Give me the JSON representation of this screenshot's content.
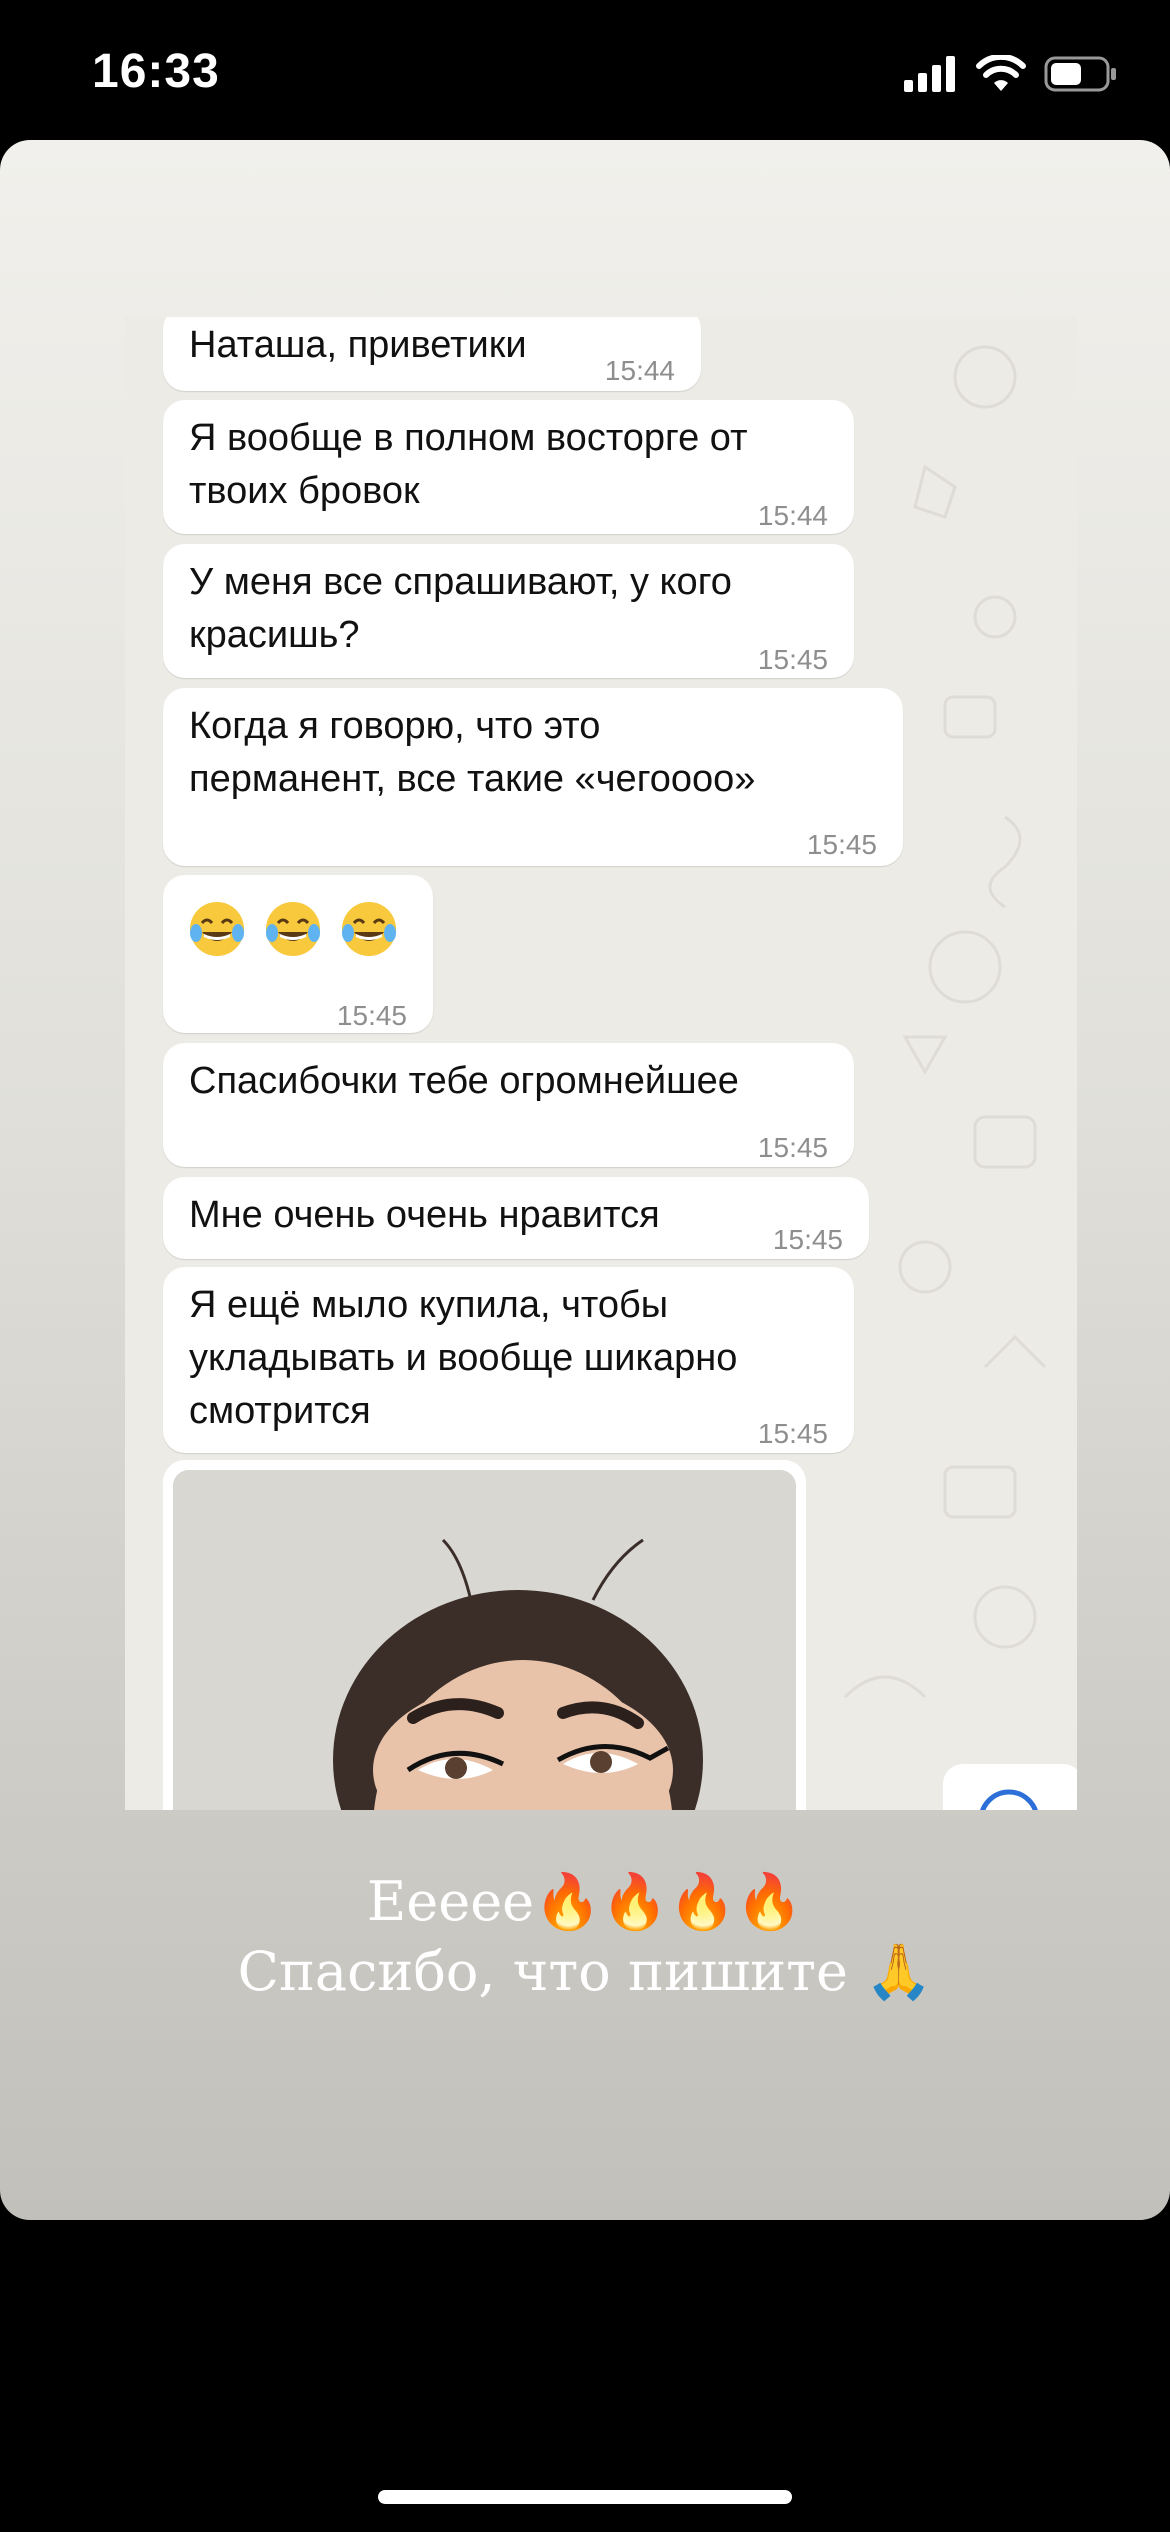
{
  "status_bar": {
    "time": "16:33",
    "battery_icon": "battery-icon",
    "wifi_icon": "wifi-icon",
    "signal_icon": "cellular-signal-icon"
  },
  "messages": [
    {
      "text": "Наташа, приветики",
      "time": "15:44"
    },
    {
      "text": "Я вообще в полном восторге от\nтвоих бровок",
      "time": "15:44"
    },
    {
      "text": "У меня все спрашивают, у кого\nкрасишь?",
      "time": "15:45"
    },
    {
      "text": "Когда я говорю, что это\nперманент, все такие «чегоооо»",
      "time": "15:45"
    },
    {
      "text": "",
      "emoji": "face-with-tears-of-joy x3",
      "time": "15:45"
    },
    {
      "text": "Спасибочки тебе огромнейшее",
      "time": "15:45"
    },
    {
      "text": "Мне очень очень нравится",
      "time": "15:45"
    },
    {
      "text": "Я ещё мыло купила, чтобы\nукладывать и вообще шикарно\nсмотрится",
      "time": "15:45"
    }
  ],
  "photo_message": {
    "icon": "photo-attachment"
  },
  "caption": {
    "line1": "Еееее🔥🔥🔥🔥",
    "line2": "Спасибо, что пишите 🙏"
  },
  "colors": {
    "bubble": "#ffffff",
    "chat_bg": "#ecebe5",
    "timestamp": "#8e8e8e"
  }
}
